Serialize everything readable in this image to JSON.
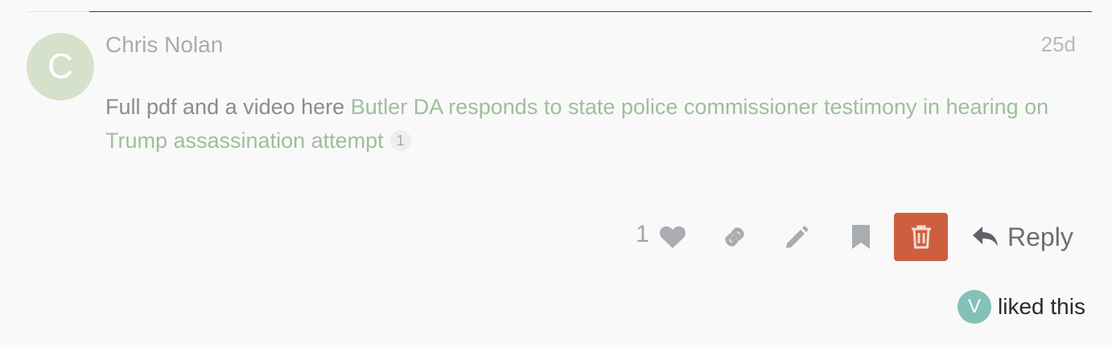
{
  "post": {
    "avatar_letter": "C",
    "username": "Chris Nolan",
    "date": "25d",
    "body_prefix": "Full pdf and a video here ",
    "link_text": "Butler DA responds to state police commissioner testimony in hearing on Trump assassination attempt",
    "link_clicks": "1"
  },
  "actions": {
    "like_count": "1",
    "like_icon": "heart-icon",
    "link_icon": "link-icon",
    "edit_icon": "pencil-icon",
    "bookmark_icon": "bookmark-icon",
    "delete_icon": "trash-icon",
    "reply_label": "Reply",
    "reply_icon": "reply-arrow-icon"
  },
  "liked_by": {
    "avatar_letter": "V",
    "text": "liked this"
  },
  "colors": {
    "avatar_bg": "#d6e1cc",
    "link": "#9dbf9a",
    "delete_bg": "#cd5f3e",
    "liker_avatar_bg": "#83c0b8"
  }
}
